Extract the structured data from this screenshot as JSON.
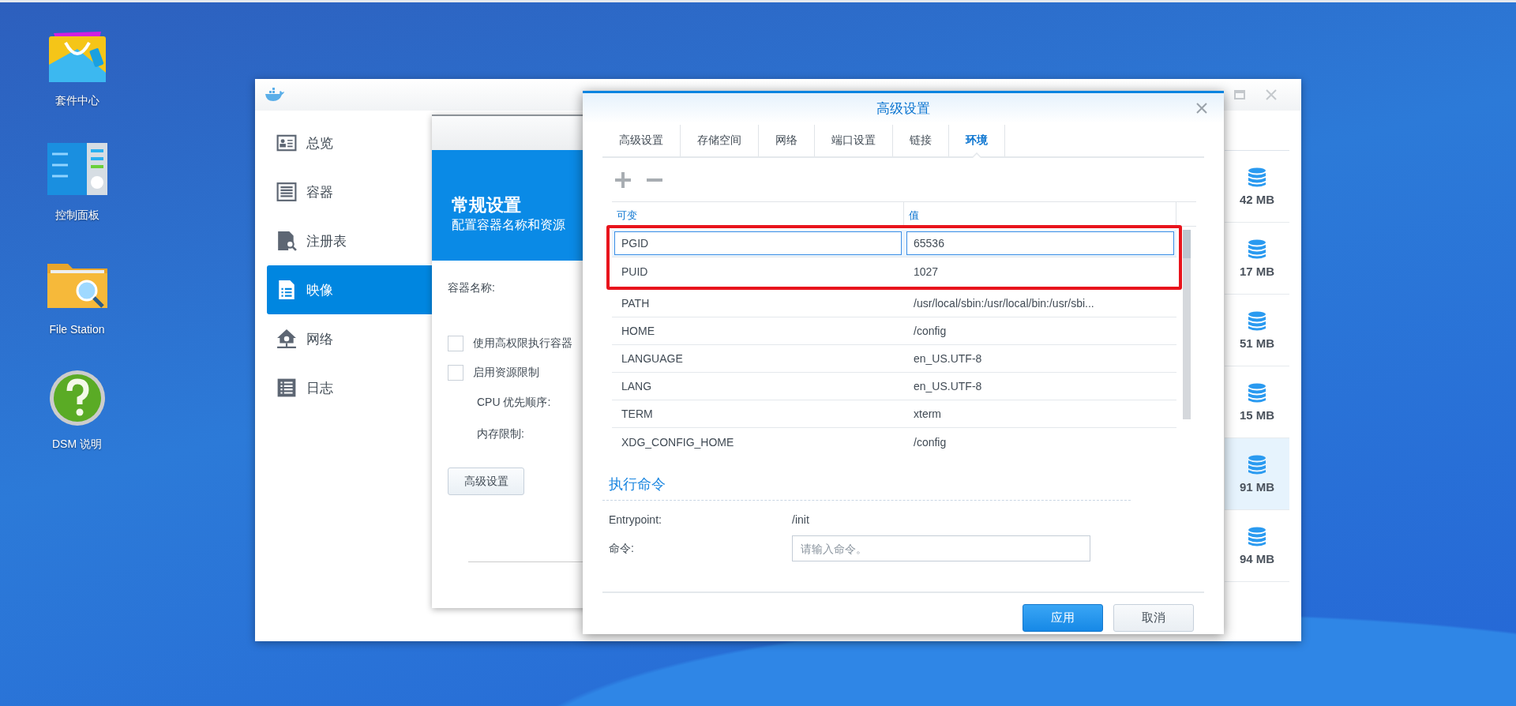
{
  "desktop_icons": [
    {
      "label": "套件中心"
    },
    {
      "label": "控制面板"
    },
    {
      "label": "File Station"
    },
    {
      "label": "DSM 说明"
    }
  ],
  "main_window": {
    "sidebar": [
      {
        "label": "总览",
        "selected": false
      },
      {
        "label": "容器",
        "selected": false
      },
      {
        "label": "注册表",
        "selected": false
      },
      {
        "label": "映像",
        "selected": true
      },
      {
        "label": "网络",
        "selected": false
      },
      {
        "label": "日志",
        "selected": false
      }
    ],
    "image_sizes": [
      {
        "size": "42 MB",
        "selected": false
      },
      {
        "size": "17 MB",
        "selected": false
      },
      {
        "size": "51 MB",
        "selected": false
      },
      {
        "size": "15 MB",
        "selected": false
      },
      {
        "size": "91 MB",
        "selected": true
      },
      {
        "size": "94 MB",
        "selected": false
      }
    ]
  },
  "general_dialog": {
    "title": "常规设置",
    "subtitle": "配置容器名称和资源",
    "name_label": "容器名称:",
    "options": [
      {
        "label": "使用高权限执行容器",
        "checked": false
      },
      {
        "label": "启用资源限制",
        "checked": false
      }
    ],
    "limits": [
      "CPU 优先顺序:",
      "内存限制:"
    ],
    "advanced_button": "高级设置"
  },
  "advanced_dialog": {
    "title": "高级设置",
    "tabs": [
      {
        "label": "高级设置",
        "selected": false
      },
      {
        "label": "存储空间",
        "selected": false
      },
      {
        "label": "网络",
        "selected": false
      },
      {
        "label": "端口设置",
        "selected": false
      },
      {
        "label": "链接",
        "selected": false
      },
      {
        "label": "环境",
        "selected": true
      }
    ],
    "table": {
      "columns": [
        "可变",
        "值"
      ],
      "marked_rows": [
        {
          "name": "PGID",
          "value": "65536",
          "editing": true
        },
        {
          "name": "PUID",
          "value": "1027",
          "editing": false
        }
      ],
      "rows": [
        {
          "name": "PATH",
          "value": "/usr/local/sbin:/usr/local/bin:/usr/sbi...",
          "editing": false
        },
        {
          "name": "HOME",
          "value": "/config",
          "editing": false
        },
        {
          "name": "LANGUAGE",
          "value": "en_US.UTF-8",
          "editing": false
        },
        {
          "name": "LANG",
          "value": "en_US.UTF-8",
          "editing": false
        },
        {
          "name": "TERM",
          "value": "xterm",
          "editing": false
        },
        {
          "name": "XDG_CONFIG_HOME",
          "value": "/config",
          "editing": false
        }
      ]
    },
    "command": {
      "heading": "执行命令",
      "entrypoint_label": "Entrypoint:",
      "entrypoint": "/init",
      "command_label": "命令:",
      "command_placeholder": "请输入命令。"
    },
    "buttons": [
      {
        "label": "应用",
        "kind": "primary"
      },
      {
        "label": "取消",
        "kind": "secondary"
      }
    ]
  }
}
